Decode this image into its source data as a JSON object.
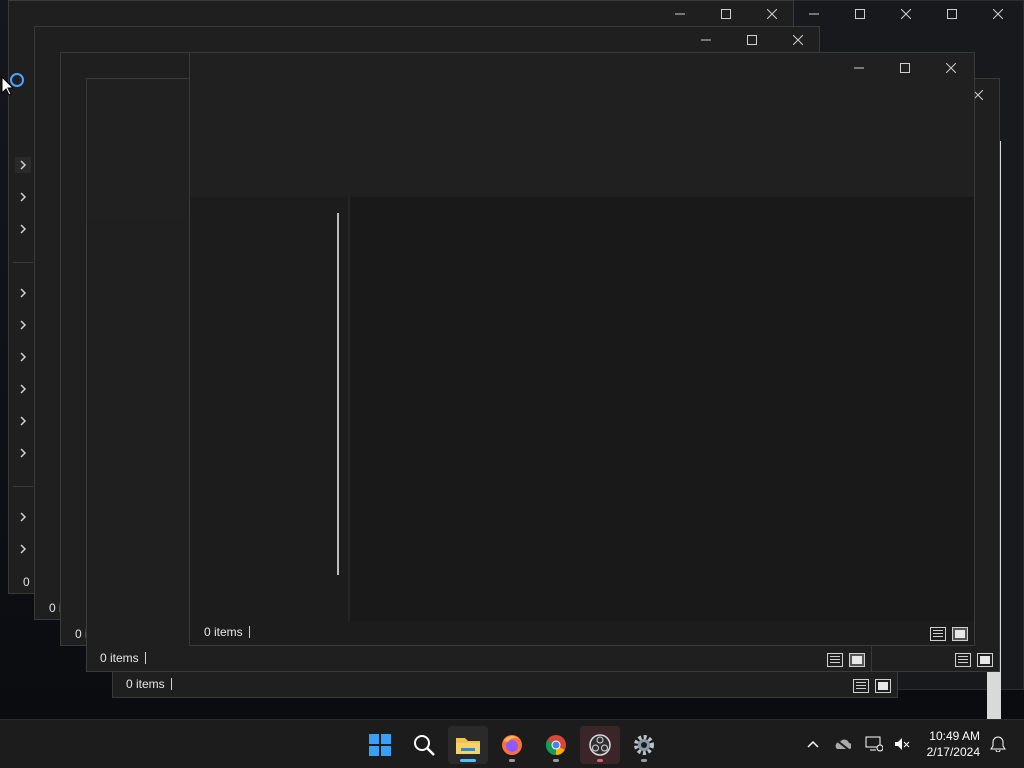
{
  "windows": [
    {
      "status_count": "0 items"
    },
    {
      "status_count": "0 items"
    },
    {
      "status_count": "0 items"
    },
    {
      "status_count": "0 items"
    }
  ],
  "partial_status": "0 i",
  "partial_status2": "0 i",
  "partial_status3": "0",
  "taskbar": {
    "apps": [
      "start-button",
      "search",
      "file-explorer",
      "firefox",
      "chrome",
      "obs-studio",
      "settings"
    ]
  },
  "clock": {
    "time": "10:49 AM",
    "date": "2/17/2024"
  },
  "colors": {
    "accent": "#4cc2ff",
    "window_bg": "#1f1f1f",
    "taskbar_bg": "#1c1c1c"
  }
}
